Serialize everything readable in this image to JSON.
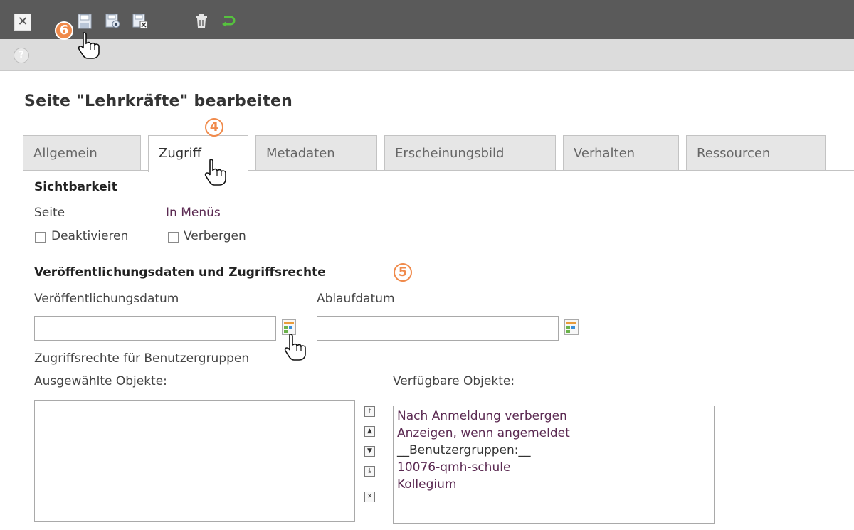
{
  "toolbar": {
    "close_icon": "close-icon",
    "save_icon": "save-icon",
    "save_view_icon": "save-view-icon",
    "save_close_icon": "save-close-icon",
    "delete_icon": "trash-icon",
    "undo_icon": "undo-icon",
    "help_icon": "help-icon"
  },
  "page": {
    "title": "Seite \"Lehrkräfte\" bearbeiten"
  },
  "tabs": [
    {
      "label": "Allgemein"
    },
    {
      "label": "Zugriff"
    },
    {
      "label": "Metadaten"
    },
    {
      "label": "Erscheinungsbild"
    },
    {
      "label": "Verhalten"
    },
    {
      "label": "Ressourcen"
    }
  ],
  "visibility": {
    "title": "Sichtbarkeit",
    "page_label": "Seite",
    "menus_label": "In Menüs",
    "deactivate_label": "Deaktivieren",
    "hide_label": "Verbergen"
  },
  "publishing": {
    "title": "Veröffentlichungsdaten und Zugriffsrechte",
    "publish_date_label": "Veröffentlichungsdatum",
    "publish_date_value": "",
    "expiry_date_label": "Ablaufdatum",
    "expiry_date_value": "",
    "access_label": "Zugriffsrechte für Benutzergruppen",
    "selected_label": "Ausgewählte Objekte:",
    "available_label": "Verfügbare Objekte:",
    "available_items": [
      "Nach Anmeldung verbergen",
      "Anzeigen, wenn angemeldet",
      "__Benutzergruppen:__",
      "10076-qmh-schule",
      "Kollegium"
    ]
  },
  "annotations": {
    "step4": "4",
    "step5": "5",
    "step6": "6"
  },
  "colors": {
    "toolbar": "#5a5a5a",
    "accent": "#f08a4b",
    "option_text": "#5b2a52"
  }
}
